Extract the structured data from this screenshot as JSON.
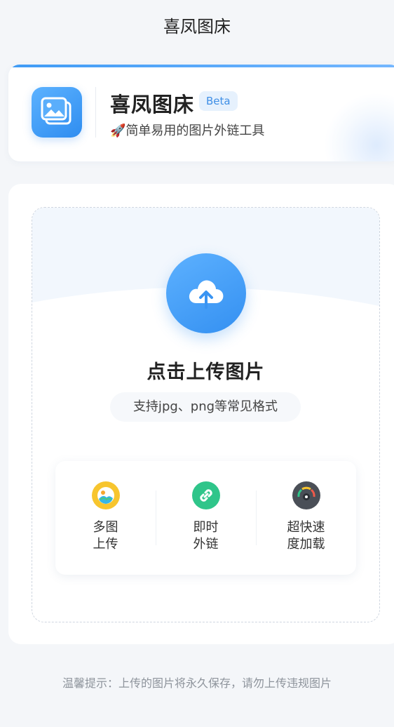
{
  "nav": {
    "title": "喜凤图床"
  },
  "header": {
    "app_name": "喜凤图床",
    "badge": "Beta",
    "tagline": "🚀简单易用的图片外链工具",
    "icon": "image-stack-icon"
  },
  "upload": {
    "icon": "cloud-upload-icon",
    "title": "点击上传图片",
    "formats": "支持jpg、png等常见格式"
  },
  "features": [
    {
      "icon": "multi-image-icon",
      "line1": "多图",
      "line2": "上传",
      "color": "#f7c52e"
    },
    {
      "icon": "link-icon",
      "line1": "即时",
      "line2": "外链",
      "color": "#2fc58a"
    },
    {
      "icon": "speedometer-icon",
      "line1": "超快速",
      "line2": "度加载",
      "color": "#4a4f57"
    }
  ],
  "footer": {
    "tip": "温馨提示：上传的图片将永久保存，请勿上传违规图片"
  },
  "colors": {
    "accent": "#3f9bf5",
    "background": "#f4f6f9"
  }
}
